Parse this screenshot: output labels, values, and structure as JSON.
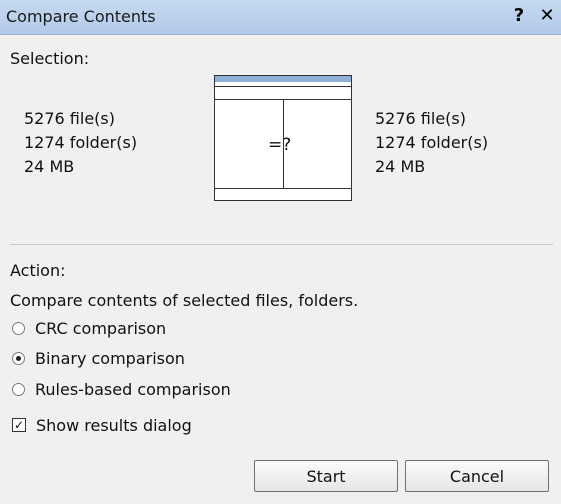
{
  "window": {
    "title": "Compare Contents",
    "help_label": "?",
    "close_label": "✕"
  },
  "selection": {
    "heading": "Selection:",
    "left": {
      "files": "5276 file(s)",
      "folders": "1274 folder(s)",
      "size": "24 MB"
    },
    "right": {
      "files": "5276 file(s)",
      "folders": "1274 folder(s)",
      "size": "24 MB"
    },
    "compare_symbol": "=?"
  },
  "action": {
    "heading": "Action:",
    "description": "Compare contents of selected files, folders.",
    "options": [
      {
        "label": "CRC comparison",
        "selected": false
      },
      {
        "label": "Binary comparison",
        "selected": true
      },
      {
        "label": "Rules-based comparison",
        "selected": false
      }
    ],
    "show_results": {
      "label": "Show results dialog",
      "checked": true,
      "check_glyph": "✓"
    }
  },
  "buttons": {
    "start": "Start",
    "cancel": "Cancel"
  }
}
